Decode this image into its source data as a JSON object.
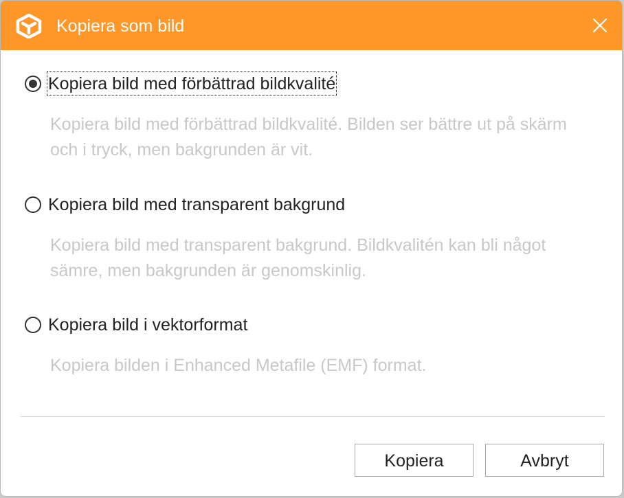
{
  "dialog": {
    "title": "Kopiera som bild",
    "accent_color": "#ff9728",
    "logo_icon": "app-cube-logo-icon",
    "close_icon": "close-icon"
  },
  "options": [
    {
      "label": "Kopiera bild med förbättrad bildkvalité",
      "description": "Kopiera bild med förbättrad bildkvalité. Bilden ser bättre ut på skärm och i tryck, men bakgrunden är vit.",
      "selected": true
    },
    {
      "label": "Kopiera bild med transparent bakgrund",
      "description": "Kopiera bild med transparent bakgrund. Bildkvalitén kan bli något sämre, men bakgrunden är genomskinlig.",
      "selected": false
    },
    {
      "label": "Kopiera bild i vektorformat",
      "description": "Kopiera bilden i Enhanced Metafile (EMF) format.",
      "selected": false
    }
  ],
  "buttons": {
    "copy_label": "Kopiera",
    "cancel_label": "Avbryt"
  }
}
